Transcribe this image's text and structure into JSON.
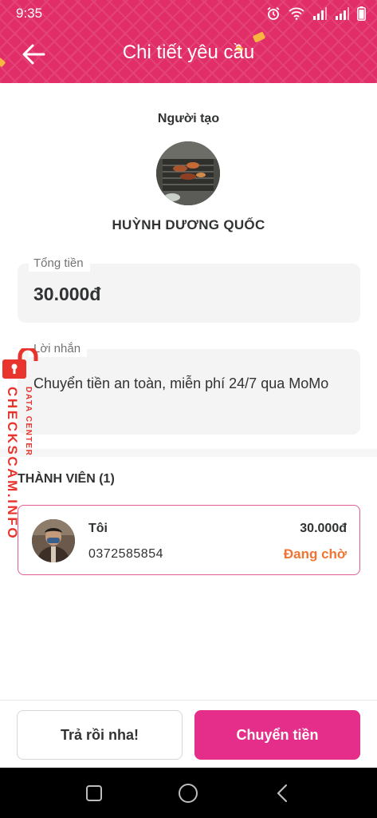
{
  "status_bar": {
    "time": "9:35",
    "icons": [
      "alarm-icon",
      "wifi-icon",
      "signal-icon",
      "signal-icon",
      "battery-icon"
    ]
  },
  "header": {
    "title": "Chi tiết yêu cầu",
    "back_icon": "arrow-left-icon",
    "color": "#e12d68"
  },
  "creator": {
    "label": "Người tạo",
    "name": "HUỲNH DƯƠNG QUỐC"
  },
  "amount": {
    "label": "Tổng tiền",
    "value": "30.000đ"
  },
  "message": {
    "label": "Lời nhắn",
    "value": "Chuyển tiền an toàn, miễn phí 24/7 qua MoMo"
  },
  "members": {
    "title": "THÀNH VIÊN (1)",
    "items": [
      {
        "name": "Tôi",
        "phone": "0372585854",
        "amount": "30.000đ",
        "status": "Đang chờ"
      }
    ]
  },
  "watermark": {
    "main": "CHECKSCAM.INFO",
    "sub": "DATA CENTER",
    "color": "#e8342c"
  },
  "actions": {
    "paid_label": "Trả rồi nha!",
    "transfer_label": "Chuyển tiền",
    "transfer_color": "#e52e8a"
  },
  "nav": {
    "icons": [
      "recents-square-icon",
      "home-circle-icon",
      "back-triangle-icon"
    ]
  },
  "colors": {
    "status_pending": "#f07434",
    "card_border": "#e55c95"
  }
}
